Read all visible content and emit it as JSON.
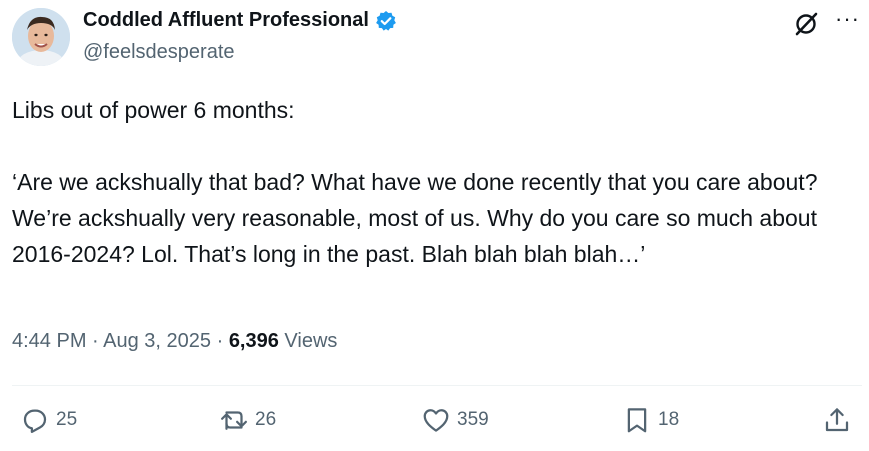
{
  "author": {
    "name": "Coddled Affluent Professional",
    "handle": "@feelsdesperate"
  },
  "tweet": {
    "line1": "Libs out of power 6 months:",
    "paragraph2": "‘Are we ackshually that bad? What have we done recently that you care about? We’re ackshually very reasonable, most of us. Why do you care so much about 2016-2024? Lol. That’s long in the past. Blah blah blah blah…’"
  },
  "meta": {
    "time": "4:44 PM",
    "separator1": " · ",
    "date": "Aug 3, 2025",
    "separator2": " · ",
    "views_count": "6,396",
    "views_label": " Views"
  },
  "actions": {
    "replies": "25",
    "reposts": "26",
    "likes": "359",
    "bookmarks": "18"
  },
  "colors": {
    "verified": "#1d9bf0",
    "secondary_text": "#536471",
    "primary_text": "#0f1419"
  }
}
